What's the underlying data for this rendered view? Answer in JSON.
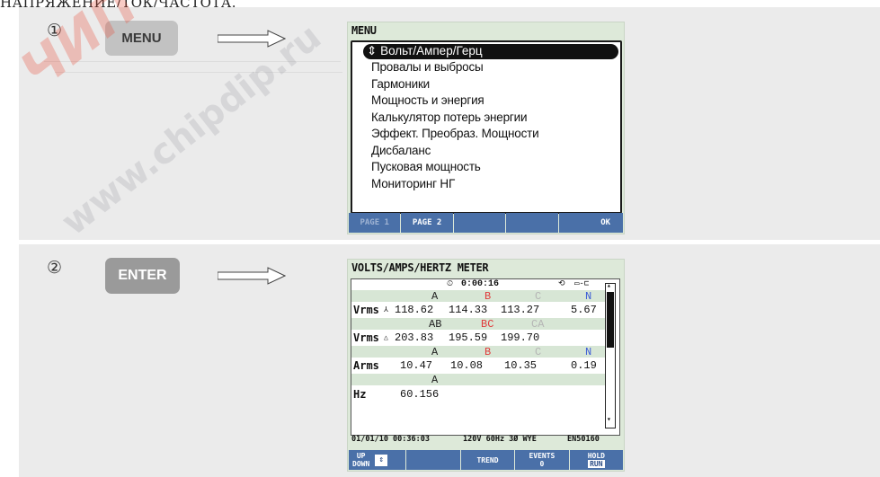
{
  "page": {
    "title": "НАПРЯЖЕНИЕ/ТОК/ЧАСТОТА."
  },
  "watermark": {
    "brand": "ЧИП И ДИП",
    "site": "www.chipdip.ru"
  },
  "steps": [
    {
      "number": "①",
      "key_label": "MENU",
      "screen": {
        "title": "MENU",
        "selected_item": "Вольт/Ампер/Герц",
        "items": [
          "Провалы и выбросы",
          "Гармоники",
          "Мощность и энергия",
          "Калькулятор потерь энергии",
          "Эффект. Преобраз. Мощности",
          "Дисбаланс",
          "Пусковая мощность",
          "Мониторинг НГ"
        ],
        "softkeys": [
          "PAGE 1",
          "PAGE 2",
          "",
          "",
          "OK"
        ]
      }
    },
    {
      "number": "②",
      "key_label": "ENTER",
      "screen": {
        "title": "VOLTS/AMPS/HERTZ METER",
        "timer": "0:00:16",
        "groups": [
          {
            "headers": [
              "A",
              "B",
              "C",
              "N"
            ],
            "label": "Vrms",
            "values": [
              "118.62",
              "114.33",
              "113.27",
              "5.67"
            ]
          },
          {
            "headers": [
              "AB",
              "BC",
              "CA"
            ],
            "label": "Vrms",
            "values": [
              "203.83",
              "195.59",
              "199.70"
            ]
          },
          {
            "headers": [
              "A",
              "B",
              "C",
              "N"
            ],
            "label": "Arms",
            "values": [
              "10.47",
              "10.08",
              "10.35",
              "0.19"
            ]
          },
          {
            "headers": [
              "A"
            ],
            "label": "Hz",
            "values": [
              "60.156"
            ]
          }
        ],
        "status": {
          "datetime": "01/01/10 00:36:03",
          "nominal": "120V  60Hz 3Ø WYE",
          "standard": "EN50160"
        },
        "softkeys": {
          "updown_top": "UP",
          "updown_bottom": "DOWN",
          "trend": "TREND",
          "events_label": "EVENTS",
          "events_count": "0",
          "hold": "HOLD",
          "run": "RUN"
        }
      }
    }
  ],
  "colors": {
    "phase_a": "#222222",
    "phase_b": "#e03a3a",
    "phase_c": "#b5b5b5",
    "phase_n": "#3b5cd6",
    "softkey_bg": "#4a70a8",
    "screen_bg": "#dde9d9"
  }
}
